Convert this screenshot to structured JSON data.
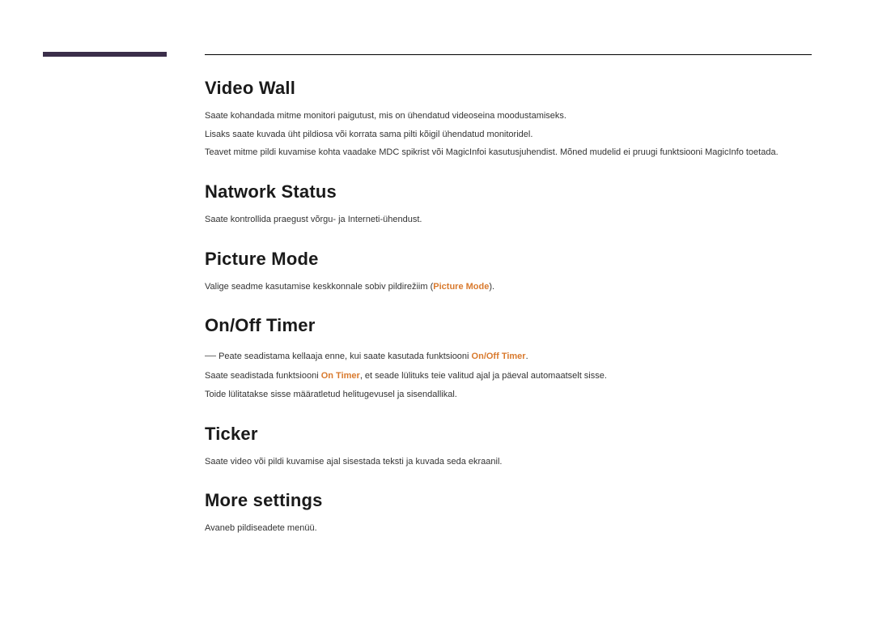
{
  "sections": {
    "videoWall": {
      "heading": "Video Wall",
      "p1": "Saate kohandada mitme monitori paigutust, mis on ühendatud videoseina moodustamiseks.",
      "p2": "Lisaks saate kuvada üht pildiosa või korrata sama pilti kõigil ühendatud monitoridel.",
      "p3": "Teavet mitme pildi kuvamise kohta vaadake MDC spikrist või MagicInfoi kasutusjuhendist. Mõned mudelid ei pruugi funktsiooni MagicInfo toetada."
    },
    "networkStatus": {
      "heading": "Natwork Status",
      "p1": "Saate kontrollida praegust võrgu- ja Interneti-ühendust."
    },
    "pictureMode": {
      "heading": "Picture Mode",
      "p1a": "Valige seadme kasutamise keskkonnale sobiv pildirežiim (",
      "p1b": "Picture Mode",
      "p1c": ")."
    },
    "onOffTimer": {
      "heading": "On/Off Timer",
      "noteA": "Peate seadistama kellaaja enne, kui saate kasutada funktsiooni ",
      "noteB": "On/Off Timer",
      "noteC": ".",
      "p2a": "Saate seadistada funktsiooni ",
      "p2b": "On Timer",
      "p2c": ", et seade lülituks teie valitud ajal ja päeval automaatselt sisse.",
      "p3": "Toide lülitatakse sisse määratletud helitugevusel ja sisendallikal."
    },
    "ticker": {
      "heading": "Ticker",
      "p1": "Saate video või pildi kuvamise ajal sisestada teksti ja kuvada seda ekraanil."
    },
    "moreSettings": {
      "heading": "More settings",
      "p1": "Avaneb pildiseadete menüü."
    }
  }
}
